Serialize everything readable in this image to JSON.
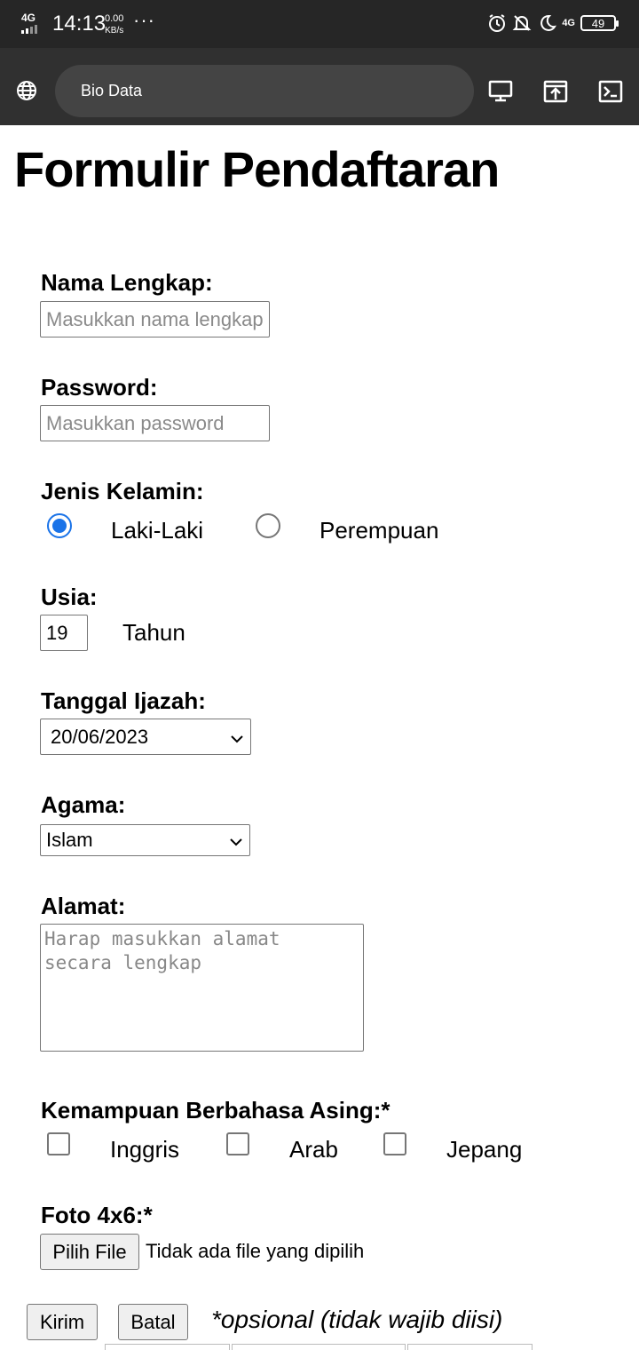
{
  "status_bar": {
    "network_left": "4G",
    "time": "14:13",
    "speed_value": "0.00",
    "speed_unit": "KB/s",
    "more": "···",
    "network_right": "4G",
    "battery": "49"
  },
  "browser": {
    "url_title": "Bio Data",
    "icons": [
      "globe-icon",
      "desktop-icon",
      "open-external-icon",
      "terminal-icon"
    ]
  },
  "form": {
    "title": "Formulir Pendaftaran",
    "nama": {
      "label": "Nama Lengkap:",
      "placeholder": "Masukkan nama lengkap"
    },
    "password": {
      "label": "Password:",
      "placeholder": "Masukkan password"
    },
    "gender": {
      "label": "Jenis Kelamin:",
      "options": [
        {
          "label": "Laki-Laki",
          "checked": true
        },
        {
          "label": "Perempuan",
          "checked": false
        }
      ]
    },
    "usia": {
      "label": "Usia:",
      "value": "19",
      "unit": "Tahun"
    },
    "ijazah": {
      "label": "Tanggal Ijazah:",
      "value": "20/06/2023"
    },
    "agama": {
      "label": "Agama:",
      "value": "Islam"
    },
    "alamat": {
      "label": "Alamat:",
      "placeholder": "Harap masukkan alamat\nsecara lengkap"
    },
    "bahasa": {
      "label": "Kemampuan Berbahasa Asing:*",
      "options": [
        "Inggris",
        "Arab",
        "Jepang"
      ]
    },
    "foto": {
      "label": "Foto 4x6:*",
      "button": "Pilih File",
      "status": "Tidak ada file yang dipilih"
    },
    "buttons": {
      "submit": "Kirim",
      "cancel": "Batal"
    },
    "note": "*opsional (tidak wajib diisi)"
  },
  "colors": {
    "status_bg": "#262626",
    "toolbar_bg": "#303030",
    "url_bg": "#444444",
    "accent": "#1a73e8"
  }
}
